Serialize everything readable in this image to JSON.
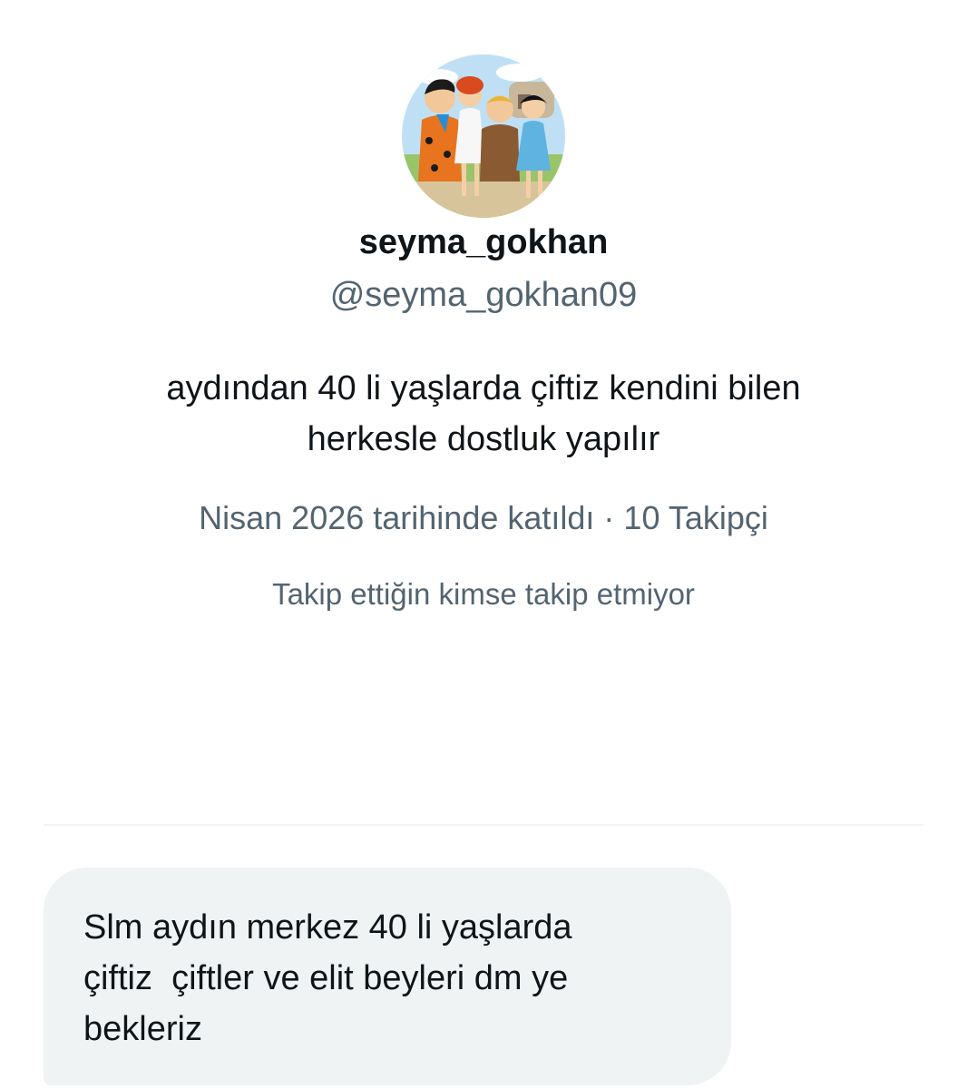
{
  "profile": {
    "display_name": "seyma_gokhan",
    "handle": "@seyma_gokhan09",
    "bio_line1": "aydından 40 li yaşlarda çiftiz kendini bilen",
    "bio_line2": "herkesle dostluk yapılır",
    "joined": "Nisan 2026 tarihinde katıldı",
    "separator": "·",
    "followers": "10 Takipçi",
    "mutual_followers": "Takip ettiğin kimse takip etmiyor",
    "avatar_icon": "cartoon-group-avatar"
  },
  "conversation": {
    "message_text": "Slm aydın merkez 40 li yaşlarda\nçiftiz  çiftler ve elit beyleri dm ye\nbekleriz"
  },
  "colors": {
    "primary_text": "#0f1419",
    "secondary_text": "#536471",
    "bubble_bg": "#eff3f4",
    "divider": "#eff3f4"
  }
}
